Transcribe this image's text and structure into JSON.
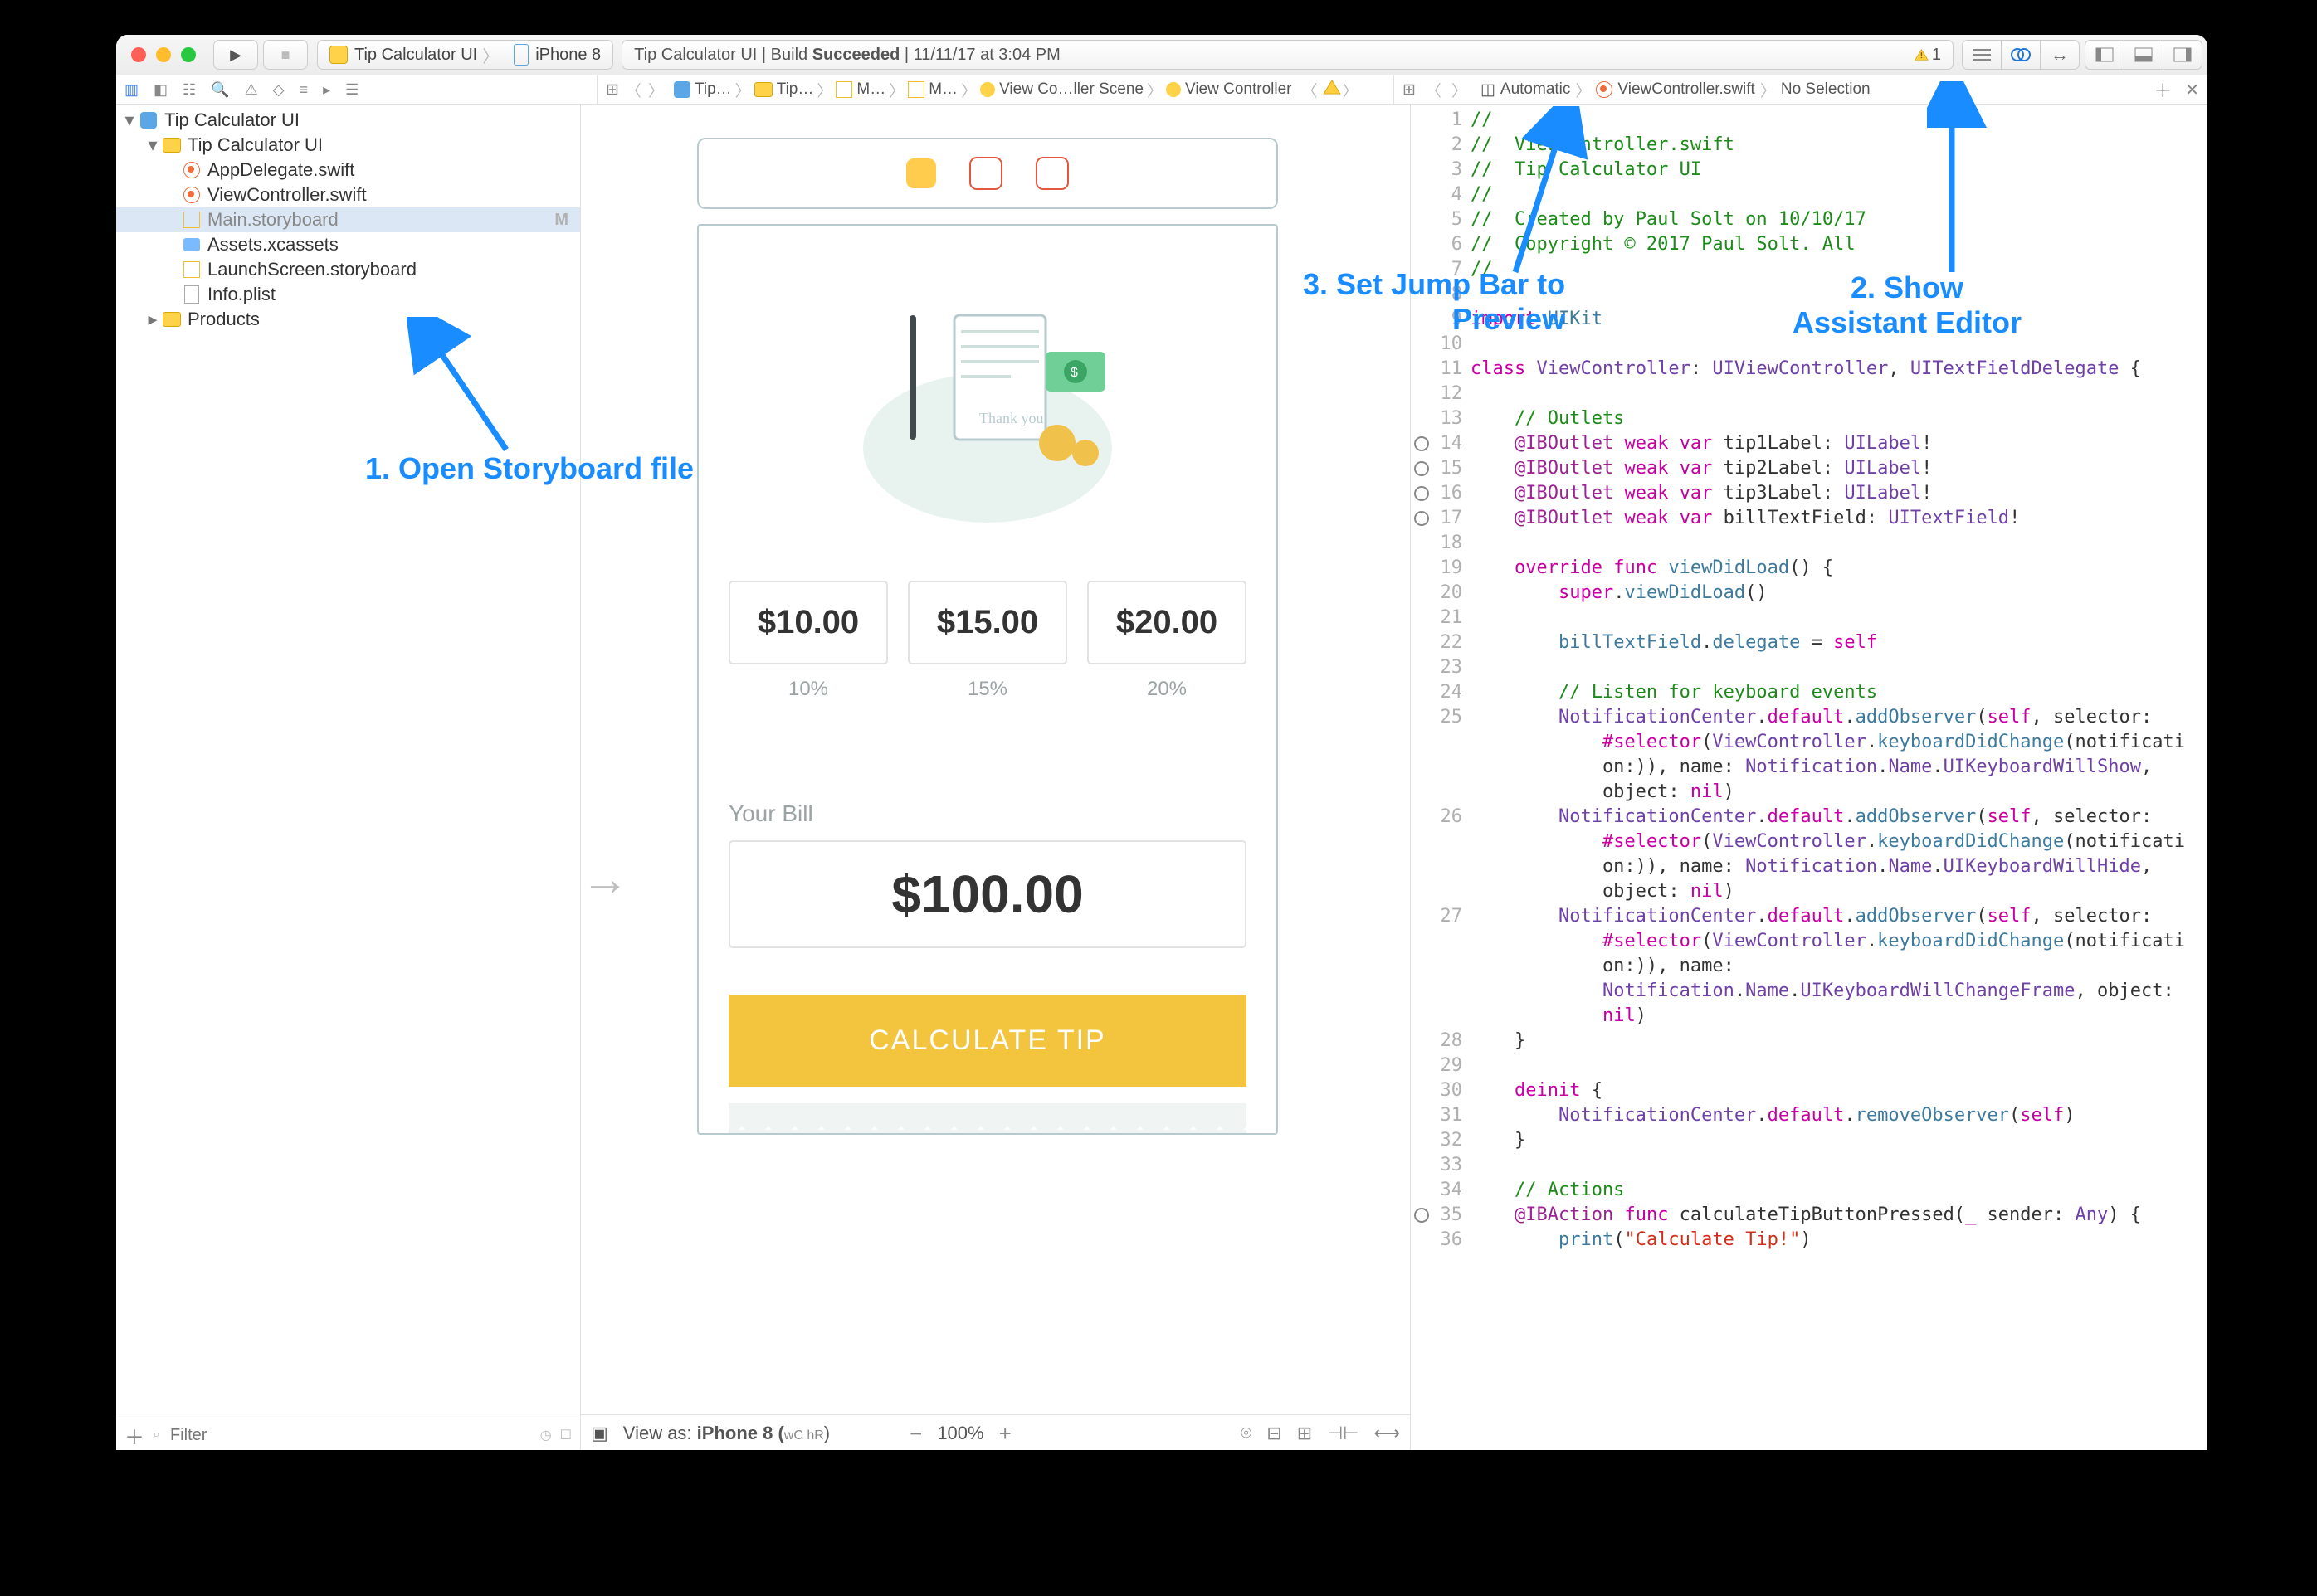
{
  "titlebar": {
    "scheme_app": "Tip Calculator UI",
    "scheme_device": "iPhone 8",
    "status_prefix": "Tip Calculator UI  |  Build ",
    "status_build": "Succeeded",
    "status_sep": "  |  ",
    "status_time": "11/11/17 at 3:04 PM",
    "warn_count": "1"
  },
  "pathbar": {
    "crumbs": [
      "Tip…",
      "Tip…",
      "M…",
      "M…",
      "View Co…ller Scene",
      "View Controller"
    ]
  },
  "assistbar": {
    "mode": "Automatic",
    "file": "ViewController.swift",
    "sel": "No Selection"
  },
  "navigator": {
    "root": "Tip Calculator UI",
    "group": "Tip Calculator UI",
    "files": [
      "AppDelegate.swift",
      "ViewController.swift",
      "Main.storyboard",
      "Assets.xcassets",
      "LaunchScreen.storyboard",
      "Info.plist"
    ],
    "products": "Products",
    "modified": "M",
    "filter_ph": "Filter"
  },
  "phone": {
    "tip_vals": [
      "$10.00",
      "$15.00",
      "$20.00"
    ],
    "tip_pcts": [
      "10%",
      "15%",
      "20%"
    ],
    "your_bill": "Your Bill",
    "bill_val": "$100.00",
    "calc": "CALCULATE TIP"
  },
  "viewbar": {
    "viewas_prefix": "View as: ",
    "viewas_device": "iPhone 8 (",
    "viewas_wc": "wC",
    "viewas_hr": " hR",
    "viewas_suffix": ")",
    "zoom": "100%"
  },
  "annotations": {
    "a1": "1. Open Storyboard file",
    "a2": "2. Show\nAssistant Editor",
    "a3": "3. Set Jump Bar to\nPreview"
  },
  "code": {
    "lines": [
      {
        "n": "1",
        "t": "comment",
        "s": "//"
      },
      {
        "n": "2",
        "t": "comment",
        "s": "//  ViewController.swift"
      },
      {
        "n": "3",
        "t": "comment",
        "s": "//  Tip Calculator UI"
      },
      {
        "n": "4",
        "t": "comment",
        "s": "//"
      },
      {
        "n": "5",
        "t": "comment",
        "s": "//  Created by Paul Solt on 10/10/17"
      },
      {
        "n": "6",
        "t": "comment",
        "s": "//  Copyright © 2017 Paul Solt. All"
      },
      {
        "n": "7",
        "t": "comment",
        "s": "//"
      },
      {
        "n": "8",
        "t": "blank",
        "s": ""
      },
      {
        "n": "9",
        "t": "import",
        "s": "import UIKit"
      },
      {
        "n": "10",
        "t": "blank",
        "s": ""
      },
      {
        "n": "11",
        "t": "class",
        "s": "class ViewController: UIViewController, UITextFieldDelegate {"
      },
      {
        "n": "12",
        "t": "blank",
        "s": ""
      },
      {
        "n": "13",
        "t": "comment2",
        "s": "    // Outlets"
      },
      {
        "n": "14",
        "t": "outlet",
        "s": "    @IBOutlet weak var tip1Label: UILabel!"
      },
      {
        "n": "15",
        "t": "outlet",
        "s": "    @IBOutlet weak var tip2Label: UILabel!"
      },
      {
        "n": "16",
        "t": "outlet",
        "s": "    @IBOutlet weak var tip3Label: UILabel!"
      },
      {
        "n": "17",
        "t": "outlet",
        "s": "    @IBOutlet weak var billTextField: UITextField!"
      },
      {
        "n": "18",
        "t": "blank",
        "s": ""
      },
      {
        "n": "19",
        "t": "override",
        "s": "    override func viewDidLoad() {"
      },
      {
        "n": "20",
        "t": "call",
        "s": "        super.viewDidLoad()"
      },
      {
        "n": "21",
        "t": "blank",
        "s": ""
      },
      {
        "n": "22",
        "t": "plain",
        "s": "        billTextField.delegate = self"
      },
      {
        "n": "23",
        "t": "blank",
        "s": ""
      },
      {
        "n": "24",
        "t": "comment2",
        "s": "        // Listen for keyboard events"
      },
      {
        "n": "25",
        "t": "obs",
        "s": "        NotificationCenter.default.addObserver(self, selector:\n            #selector(ViewController.keyboardDidChange(notificati\n            on:)), name: Notification.Name.UIKeyboardWillShow,\n            object: nil)"
      },
      {
        "n": "26",
        "t": "obs",
        "s": "        NotificationCenter.default.addObserver(self, selector:\n            #selector(ViewController.keyboardDidChange(notificati\n            on:)), name: Notification.Name.UIKeyboardWillHide,\n            object: nil)"
      },
      {
        "n": "27",
        "t": "obs",
        "s": "        NotificationCenter.default.addObserver(self, selector:\n            #selector(ViewController.keyboardDidChange(notificati\n            on:)), name:\n            Notification.Name.UIKeyboardWillChangeFrame, object:\n            nil)"
      },
      {
        "n": "28",
        "t": "plain",
        "s": "    }"
      },
      {
        "n": "29",
        "t": "blank",
        "s": ""
      },
      {
        "n": "30",
        "t": "deinit",
        "s": "    deinit {"
      },
      {
        "n": "31",
        "t": "call",
        "s": "        NotificationCenter.default.removeObserver(self)"
      },
      {
        "n": "32",
        "t": "plain",
        "s": "    }"
      },
      {
        "n": "33",
        "t": "blank",
        "s": ""
      },
      {
        "n": "34",
        "t": "comment2",
        "s": "    // Actions"
      },
      {
        "n": "35",
        "t": "action",
        "s": "    @IBAction func calculateTipButtonPressed(_ sender: Any) {"
      },
      {
        "n": "36",
        "t": "print",
        "s": "        print(\"Calculate Tip!\")"
      }
    ]
  }
}
